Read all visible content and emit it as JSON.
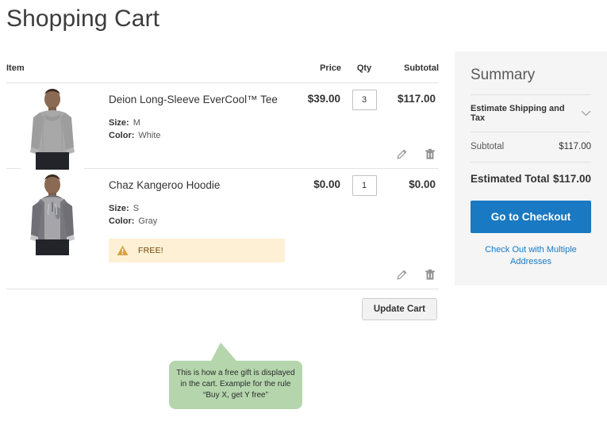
{
  "page": {
    "title": "Shopping Cart"
  },
  "cart": {
    "headers": {
      "item": "Item",
      "price": "Price",
      "qty": "Qty",
      "subtotal": "Subtotal"
    },
    "items": [
      {
        "name": "Deion Long-Sleeve EverCool™ Tee",
        "price": "$39.00",
        "qty": "3",
        "subtotal": "$117.00",
        "options": [
          {
            "label": "Size:",
            "value": "M"
          },
          {
            "label": "Color:",
            "value": "White"
          }
        ],
        "image_alt": "deion-tee-photo",
        "edit_icon": "pencil-icon",
        "remove_icon": "trash-icon"
      },
      {
        "name": "Chaz Kangeroo Hoodie",
        "price": "$0.00",
        "qty": "1",
        "subtotal": "$0.00",
        "options": [
          {
            "label": "Size:",
            "value": "S"
          },
          {
            "label": "Color:",
            "value": "Gray"
          }
        ],
        "gift_notice": {
          "icon": "warning-triangle-icon",
          "text": "FREE!"
        },
        "image_alt": "chaz-hoodie-photo",
        "edit_icon": "pencil-icon",
        "remove_icon": "trash-icon"
      }
    ],
    "update_button": "Update Cart"
  },
  "summary": {
    "title": "Summary",
    "estimate": {
      "label": "Estimate Shipping and Tax",
      "icon": "chevron-down-icon"
    },
    "subtotal_label": "Subtotal",
    "subtotal_value": "$117.00",
    "total_label": "Estimated Total",
    "total_value": "$117.00",
    "checkout_button": "Go to Checkout",
    "multiple_addresses_link": "Check Out with Multiple Addresses"
  },
  "callout": {
    "line1": "This is how a free gift is displayed",
    "line2": "in the cart. Example for the rule",
    "line3": "“Buy X, get Y free”"
  },
  "colors": {
    "accent_blue": "#1979c3",
    "gift_bg": "#fdf0d5",
    "gift_icon": "#d9a23a",
    "callout_green": "#b5d6ad",
    "panel_bg": "#f5f5f5",
    "divider": "#e3e3e3"
  }
}
